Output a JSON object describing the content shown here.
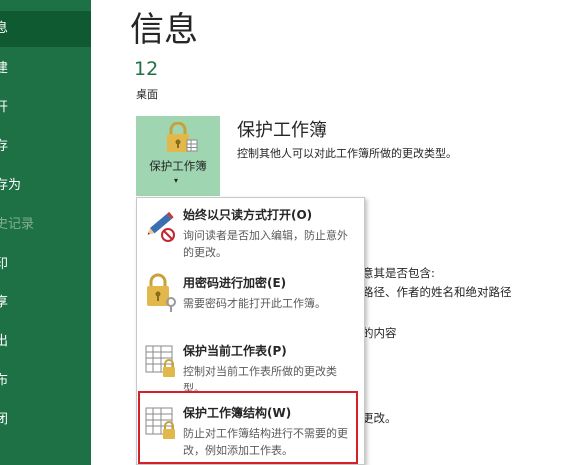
{
  "sidebar": {
    "items": [
      {
        "label": "息",
        "state": "active"
      },
      {
        "label": "建",
        "state": "normal"
      },
      {
        "label": "开",
        "state": "normal"
      },
      {
        "label": "存",
        "state": "normal"
      },
      {
        "label": "存为",
        "state": "normal"
      },
      {
        "label": "史记录",
        "state": "disabled"
      },
      {
        "label": "印",
        "state": "normal"
      },
      {
        "label": "享",
        "state": "normal"
      },
      {
        "label": "出",
        "state": "normal"
      },
      {
        "label": "布",
        "state": "normal"
      },
      {
        "label": "闭",
        "state": "normal"
      }
    ]
  },
  "page": {
    "title": "信息",
    "file_name": "12",
    "file_location": "桌面"
  },
  "protect": {
    "button_label": "保护工作簿",
    "section_title": "保护工作簿",
    "section_desc": "控制其他人可以对此工作簿所做的更改类型。"
  },
  "background_text": {
    "line1": "意其是否包含:",
    "line2": "路径、作者的姓名和绝对路径",
    "line3": "的内容",
    "line4": "更改。"
  },
  "menu": {
    "items": [
      {
        "title": "始终以只读方式打开(O)",
        "desc": "询问读者是否加入编辑，防止意外的更改。",
        "icon": "pencil-no-icon"
      },
      {
        "title": "用密码进行加密(E)",
        "desc": "需要密码才能打开此工作簿。",
        "icon": "lock-key-icon"
      },
      {
        "title": "保护当前工作表(P)",
        "desc": "控制对当前工作表所做的更改类型。",
        "icon": "sheet-lock-icon"
      },
      {
        "title": "保护工作簿结构(W)",
        "desc": "防止对工作簿结构进行不需要的更改，例如添加工作表。",
        "icon": "workbook-lock-icon"
      }
    ]
  },
  "colors": {
    "sidebar": "#1e7145",
    "sidebar_active": "#0f5a30",
    "accent": "#1e7145",
    "protect_button": "#9fd5b1",
    "highlight_border": "#d32029"
  }
}
